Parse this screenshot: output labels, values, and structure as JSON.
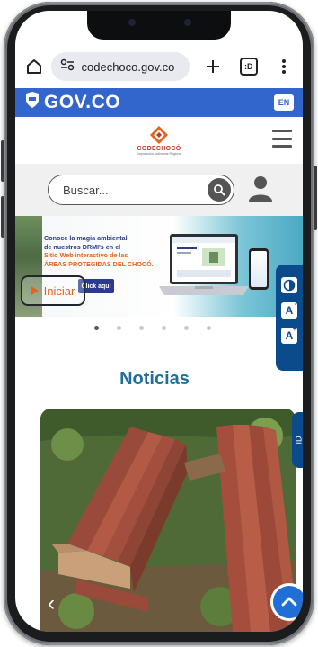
{
  "browser": {
    "url": "codechoco.gov.co",
    "tab_indicator": ":D",
    "icons": [
      "home-icon",
      "site-settings-icon",
      "plus-icon",
      "tabs-icon",
      "more-vert-icon"
    ]
  },
  "gov_bar": {
    "logo_text": "GOV.CO",
    "lang_label": "EN",
    "color": "#3366cc"
  },
  "site": {
    "brand_name": "CODECHOCÓ",
    "brand_tagline": "Corporación Autónoma Regional"
  },
  "search": {
    "placeholder": "Buscar..."
  },
  "banner": {
    "line1": "Conoce la magia ambiental",
    "line2": "de nuestros DRMI's en el",
    "line3": "Sitio Web interactivo de las",
    "line4": "ÁREAS PROTEGIDAS DEL CHOCÓ.",
    "cta": "Click aquí",
    "play_label": "Iniciar"
  },
  "carousel": {
    "total": 6,
    "active": 0
  },
  "accessibility": {
    "contrast_icon": "contrast-icon",
    "decrease_label": "A",
    "increase_label": "A"
  },
  "news": {
    "title": "Noticias",
    "side_tab_label": "ID"
  },
  "colors": {
    "accent_blue": "#1f6f9c",
    "panel_blue": "#0b4a8b",
    "orange": "#e8631a",
    "top_button": "#1f6fd6"
  }
}
